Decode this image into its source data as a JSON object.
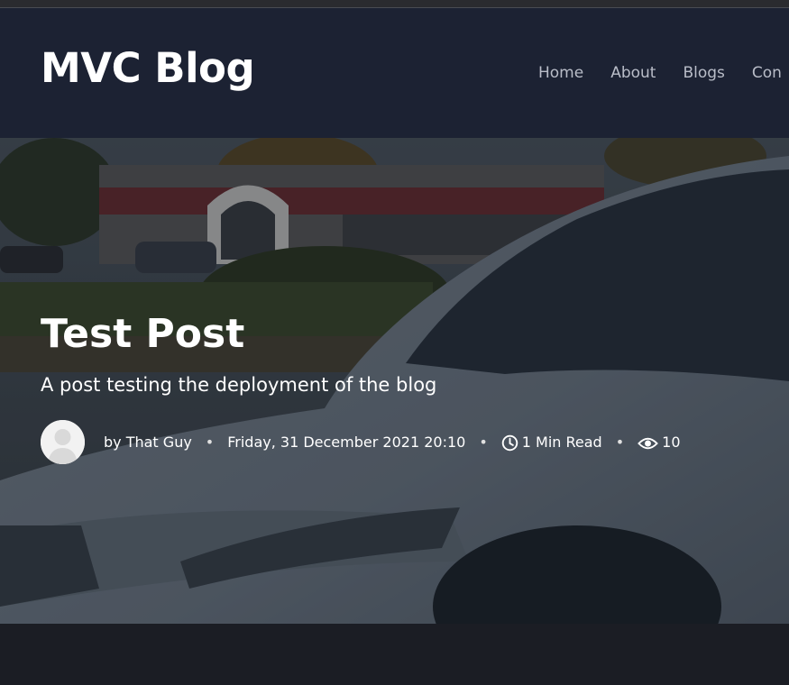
{
  "brand": "MVC Blog",
  "nav": {
    "home": "Home",
    "about": "About",
    "blogs": "Blogs",
    "contact": "Con"
  },
  "post": {
    "title": "Test Post",
    "subtitle": "A post testing the deployment of the blog",
    "author": "by That Guy",
    "date": "Friday, 31 December 2021 20:10",
    "read_time": "1 Min Read",
    "views": "10",
    "separator": "•"
  },
  "icons": {
    "avatar": "user-avatar",
    "clock": "clock-icon",
    "eye": "eye-icon"
  },
  "colors": {
    "navbar": "#1c2233",
    "page_background": "#1b1d24",
    "nav_link": "#b9bdc8"
  }
}
